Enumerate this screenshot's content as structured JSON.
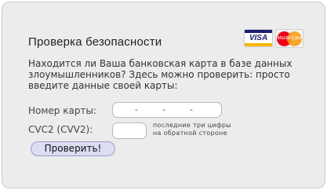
{
  "form": {
    "title": "Проверка безопасности",
    "description_lines": [
      "Находится ли Ваша банковская карта в базе данных",
      "злоумышленников? Здесь можно проверить: просто",
      "введите данные своей карты:"
    ],
    "card_number_label": "Номер карты:",
    "card_number_placeholder_separator": "-",
    "cvc_label": "CVC2 (CVV2):",
    "cvc_hint_lines": [
      "последние три цифры",
      "на обратной стороне"
    ],
    "submit_label": "Проверить!"
  },
  "logos": {
    "visa_text": "VISA",
    "mastercard_text": "MasterCard"
  },
  "colors": {
    "panel_background": "#ececec",
    "button_background": "#dcdcf3",
    "button_border": "#9c9cc9",
    "visa_blue": "#1a1f71",
    "mastercard_red": "#eb001b",
    "mastercard_orange": "#f79e1b"
  }
}
